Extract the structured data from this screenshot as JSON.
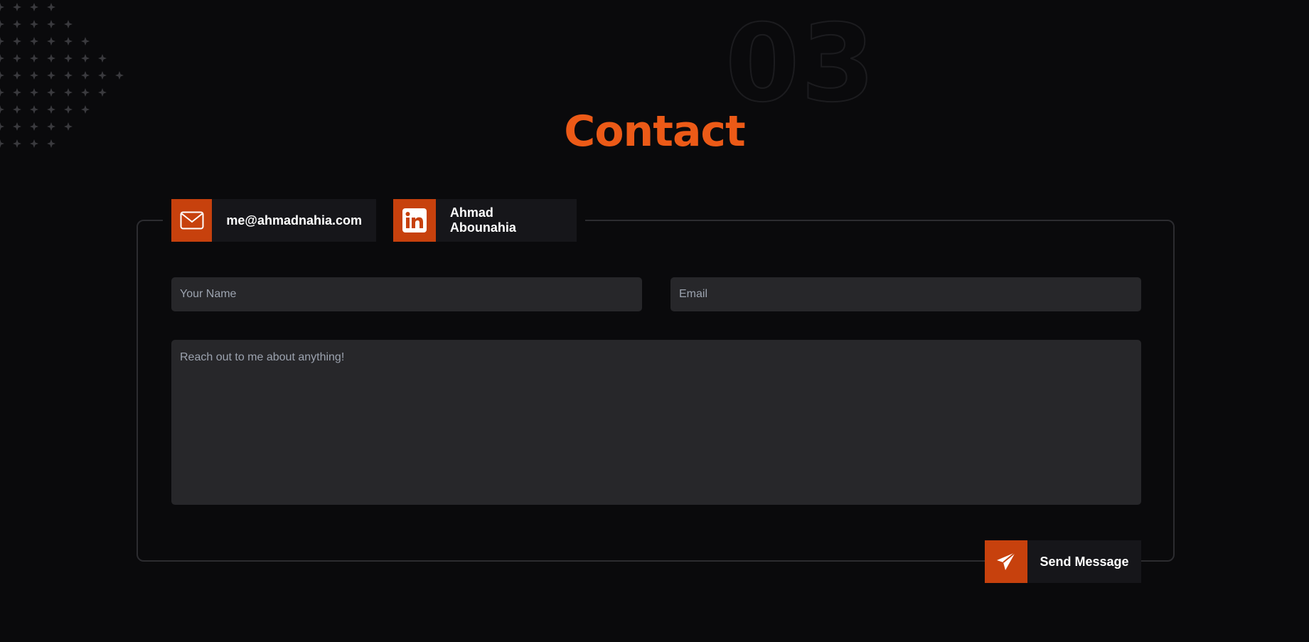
{
  "section": {
    "number": "03",
    "title": "Contact"
  },
  "contact_links": [
    {
      "label": "me@ahmadnahia.com",
      "icon": "mail-icon"
    },
    {
      "label": "Ahmad Abounahia",
      "icon": "linkedin-icon"
    }
  ],
  "form": {
    "name_placeholder": "Your Name",
    "email_placeholder": "Email",
    "message_placeholder": "Reach out to me about anything!",
    "submit_label": "Send Message",
    "submit_icon": "paper-plane-icon"
  },
  "colors": {
    "accent": "#ec5a17",
    "accent_dark": "#c7410d",
    "background": "#0a0a0c",
    "input_bg": "#27272a",
    "badge_bg": "#16161a"
  }
}
